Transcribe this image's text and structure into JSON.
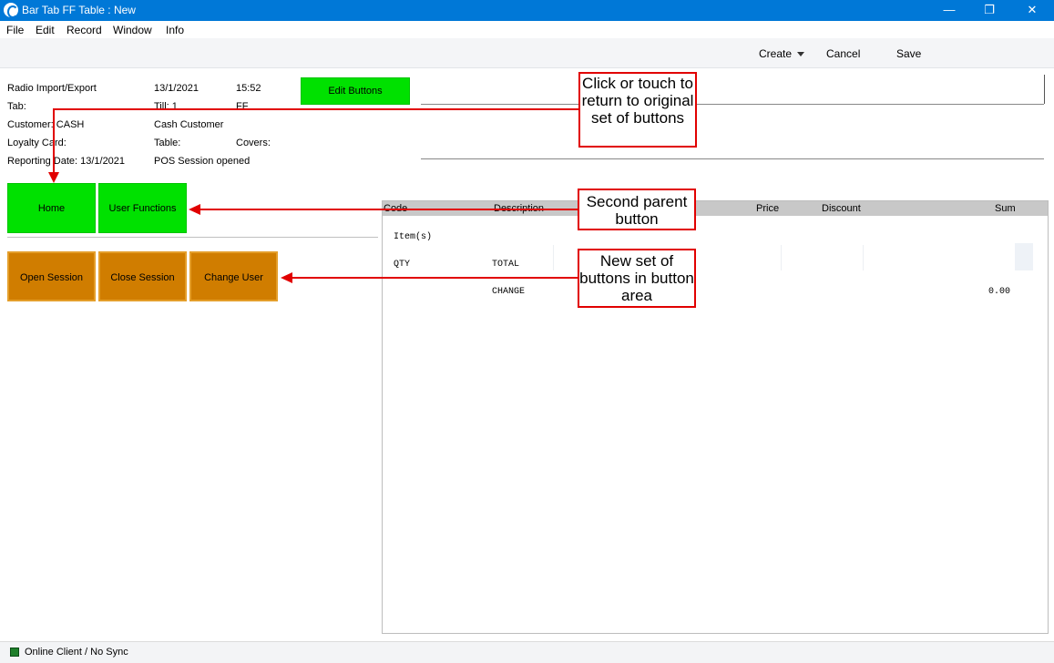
{
  "window": {
    "title": "Bar Tab FF Table : New",
    "controls": {
      "minimize": "—",
      "restore": "❐",
      "close": "✕"
    }
  },
  "menu": [
    "File",
    "Edit",
    "Record",
    "Window",
    "Info"
  ],
  "toolbar": {
    "create": "Create",
    "cancel": "Cancel",
    "save": "Save"
  },
  "header": {
    "radio": "Radio Import/Export",
    "date": "13/1/2021",
    "time": "15:52",
    "tab": "Tab:",
    "till": "Till: 1",
    "till_code": "FF",
    "customer": "Customer: CASH",
    "customer_name": "Cash Customer",
    "loyalty": "Loyalty Card:",
    "table": "Table:",
    "covers": "Covers:",
    "reporting": "Reporting Date: 13/1/2021",
    "session": "POS Session opened",
    "edit_buttons": "Edit Buttons"
  },
  "parent_buttons": [
    "Home",
    "User Functions"
  ],
  "buttons": [
    "Open Session",
    "Close Session",
    "Change User"
  ],
  "grid": {
    "columns": [
      "Code",
      "Description",
      "Price",
      "Discount",
      "Sum"
    ],
    "items_label": "Item(s)",
    "qty": "QTY",
    "total": "TOTAL",
    "change": "CHANGE",
    "change_value": "0.00"
  },
  "callouts": {
    "c1": "Click or touch to return to original set of buttons",
    "c2": "Second parent button",
    "c3": "New set of buttons in button area"
  },
  "status": {
    "text": "Online Client / No Sync",
    "indicator_color": "#1e7f2a"
  },
  "colors": {
    "titlebar": "#0078d7",
    "green_button": "#00e100",
    "orange_button": "#d07d00",
    "callout_red": "#e10000"
  }
}
